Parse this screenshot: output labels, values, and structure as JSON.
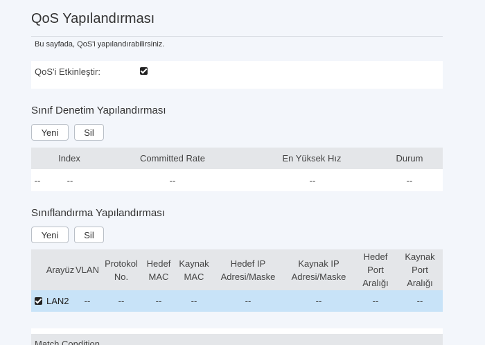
{
  "page": {
    "title": "QoS Yapılandırması",
    "description": "Bu sayfada, QoS'i yapılandırabilirsiniz."
  },
  "enable": {
    "label": "QoS'i Etkinleştir:",
    "checked": true
  },
  "class_inspection": {
    "title": "Sınıf Denetim Yapılandırması",
    "new_label": "Yeni",
    "delete_label": "Sil",
    "headers": [
      "Index",
      "Committed Rate",
      "En Yüksek Hız",
      "Durum"
    ],
    "row": {
      "select": "--",
      "index": "--",
      "committed_rate": "--",
      "max_rate": "--",
      "status": "--"
    }
  },
  "classification": {
    "title": "Sınıflandırma Yapılandırması",
    "new_label": "Yeni",
    "delete_label": "Sil",
    "headers": {
      "interface": "Arayüz",
      "vlan": "VLAN",
      "protocol_1": "Protokol",
      "protocol_2": "No.",
      "dest_mac_1": "Hedef",
      "dest_mac_2": "MAC",
      "src_mac_1": "Kaynak",
      "src_mac_2": "MAC",
      "dest_ip_1": "Hedef IP",
      "dest_ip_2": "Adresi/Maske",
      "src_ip_1": "Kaynak IP",
      "src_ip_2": "Adresi/Maske",
      "dest_port_1": "Hedef",
      "dest_port_2": "Port",
      "dest_port_3": "Aralığı",
      "src_port_1": "Kaynak",
      "src_port_2": "Port",
      "src_port_3": "Aralığı"
    },
    "row": {
      "checked": true,
      "interface": "LAN2",
      "vlan": "--",
      "protocol": "--",
      "dest_mac": "--",
      "src_mac": "--",
      "dest_ip": "--",
      "src_ip": "--",
      "dest_port": "--",
      "src_port": "--"
    }
  },
  "match": {
    "title": "Match Condition"
  }
}
